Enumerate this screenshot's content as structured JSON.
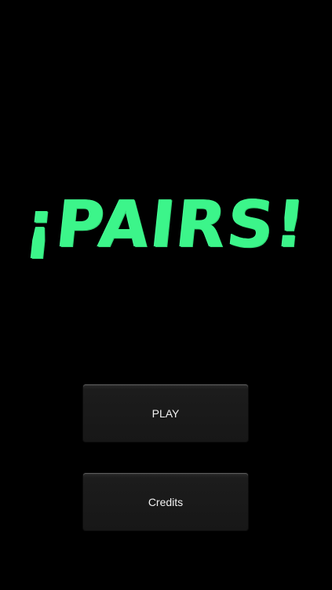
{
  "app": {
    "title": "¡PAIRS!"
  },
  "menu": {
    "play_label": "PLAY",
    "credits_label": "Credits"
  },
  "colors": {
    "background": "#000000",
    "title": "#3CF58A",
    "button": "#1c1c1c",
    "button_text": "#f2f2f2"
  }
}
